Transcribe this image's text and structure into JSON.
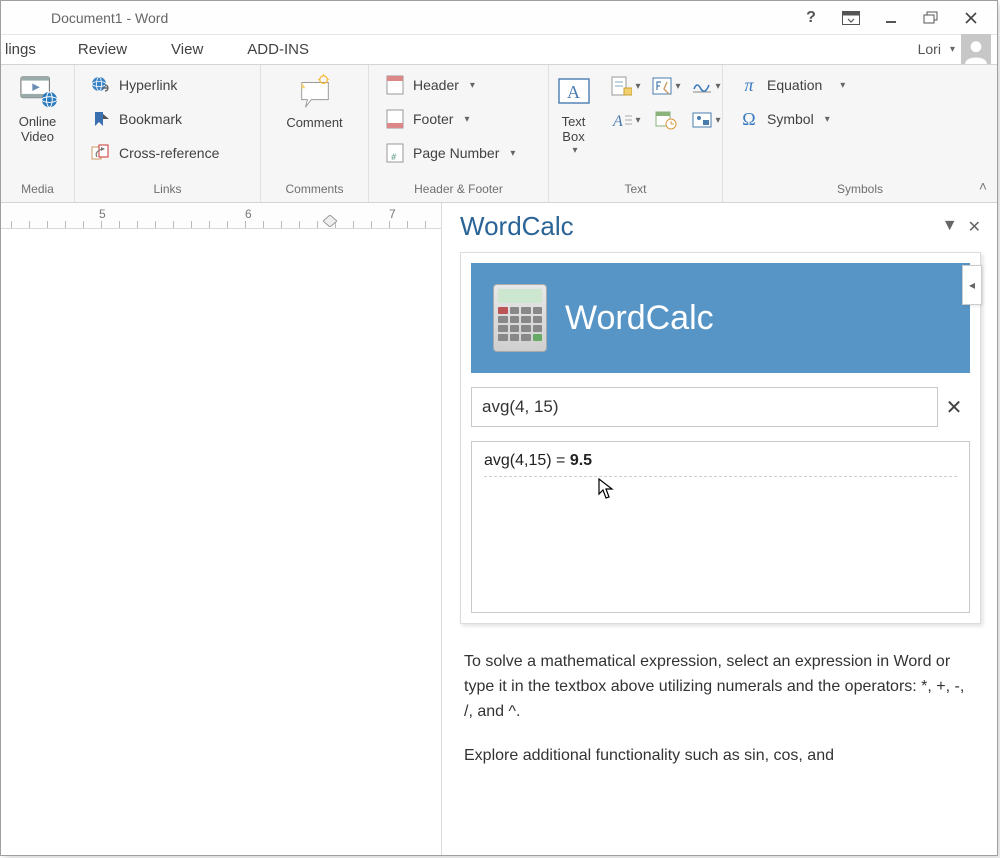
{
  "window_title": "Document1 - Word",
  "user_name": "Lori",
  "ribbon_tabs": {
    "partial_first": "lings",
    "t1": "Review",
    "t2": "View",
    "t3": "ADD-INS"
  },
  "ribbon": {
    "media": {
      "label": "Media",
      "online_video": "Online\nVideo"
    },
    "links": {
      "label": "Links",
      "hyperlink": "Hyperlink",
      "bookmark": "Bookmark",
      "crossref": "Cross-reference"
    },
    "comments": {
      "label": "Comments",
      "comment": "Comment"
    },
    "headerfooter": {
      "label": "Header & Footer",
      "header": "Header",
      "footer": "Footer",
      "page_number": "Page Number"
    },
    "text": {
      "label": "Text",
      "text_box": "Text\nBox"
    },
    "symbols": {
      "label": "Symbols",
      "equation": "Equation",
      "symbol": "Symbol"
    }
  },
  "ruler": {
    "n5": "5",
    "n6": "6",
    "n7": "7"
  },
  "task_pane": {
    "title": "WordCalc",
    "header_title": "WordCalc",
    "expression_value": "avg(4, 15)",
    "result_prefix": "avg(4,15) = ",
    "result_value": "9.5",
    "help1": "To solve a mathematical expression, select an expression in Word or type it in the textbox above utilizing numerals and the operators: *, +, -, /, and ^.",
    "help2": "Explore additional functionality such as sin, cos, and"
  }
}
